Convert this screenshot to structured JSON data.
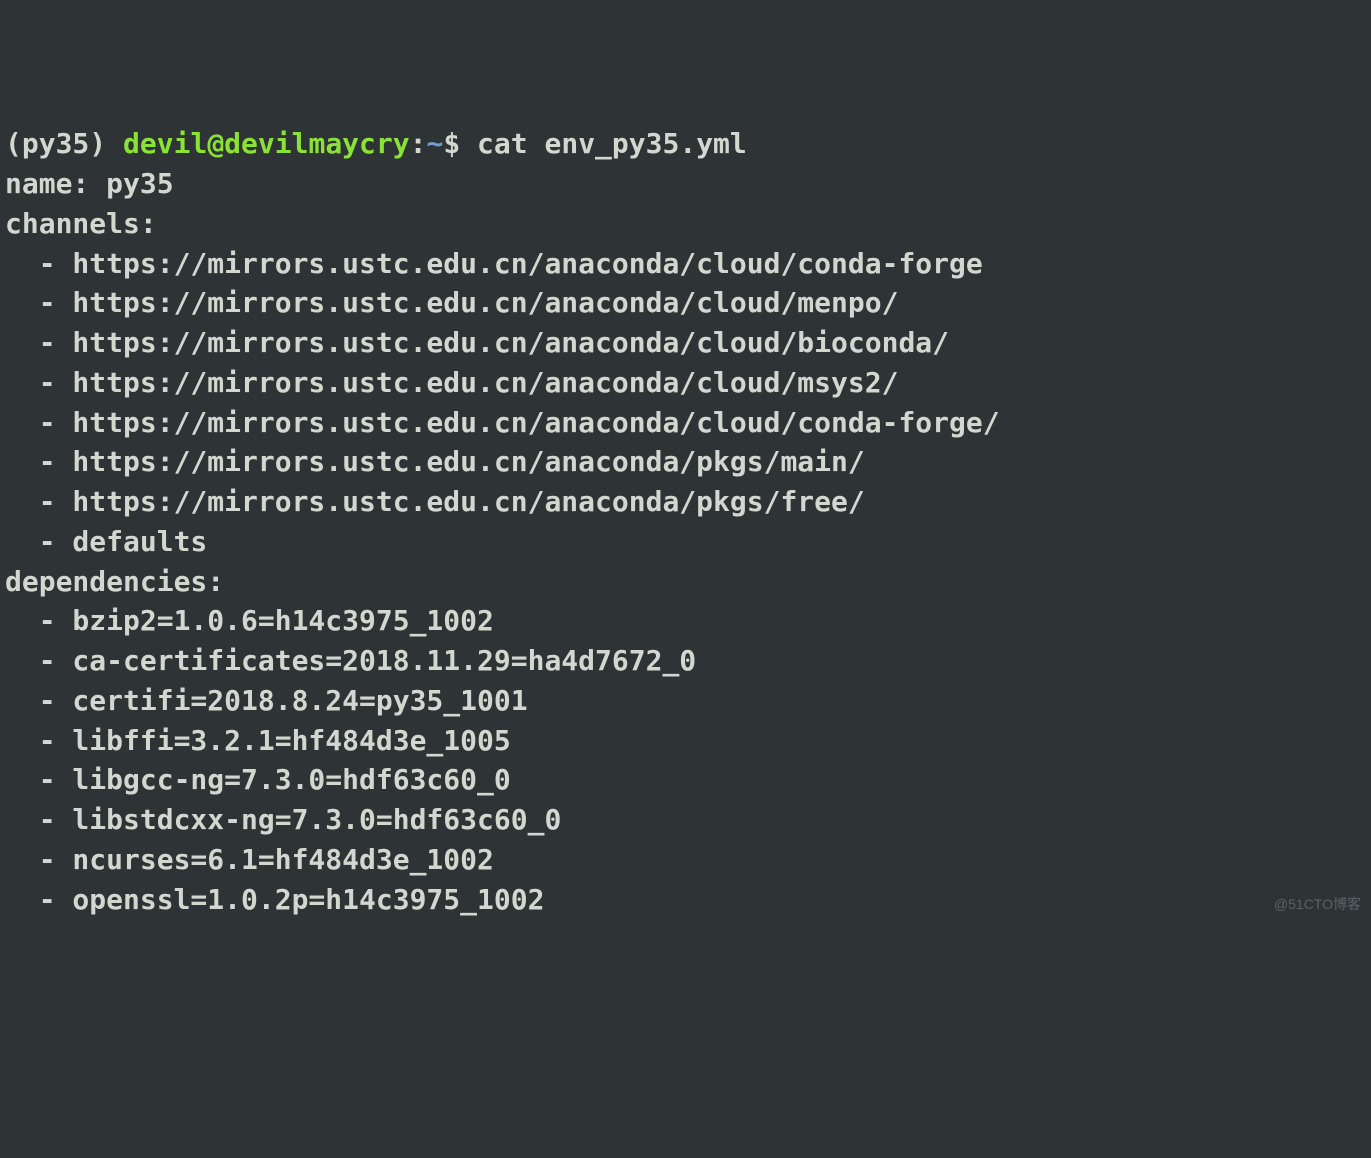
{
  "prompt": {
    "env": "(py35) ",
    "user": "devil",
    "at": "@",
    "host": "devilmaycry",
    "colon": ":",
    "path": "~",
    "dollar": "$ ",
    "command": "cat env_py35.yml"
  },
  "yaml": {
    "name_key": "name: ",
    "name_value": "py35",
    "channels_key": "channels:",
    "channels": [
      "  - https://mirrors.ustc.edu.cn/anaconda/cloud/conda-forge",
      "  - https://mirrors.ustc.edu.cn/anaconda/cloud/menpo/",
      "  - https://mirrors.ustc.edu.cn/anaconda/cloud/bioconda/",
      "  - https://mirrors.ustc.edu.cn/anaconda/cloud/msys2/",
      "  - https://mirrors.ustc.edu.cn/anaconda/cloud/conda-forge/",
      "  - https://mirrors.ustc.edu.cn/anaconda/pkgs/main/",
      "  - https://mirrors.ustc.edu.cn/anaconda/pkgs/free/",
      "  - defaults"
    ],
    "dependencies_key": "dependencies:",
    "dependencies": [
      "  - bzip2=1.0.6=h14c3975_1002",
      "  - ca-certificates=2018.11.29=ha4d7672_0",
      "  - certifi=2018.8.24=py35_1001",
      "  - libffi=3.2.1=hf484d3e_1005",
      "  - libgcc-ng=7.3.0=hdf63c60_0",
      "  - libstdcxx-ng=7.3.0=hdf63c60_0",
      "  - ncurses=6.1=hf484d3e_1002",
      "  - openssl=1.0.2p=h14c3975_1002"
    ]
  },
  "watermark": "@51CTO博客"
}
